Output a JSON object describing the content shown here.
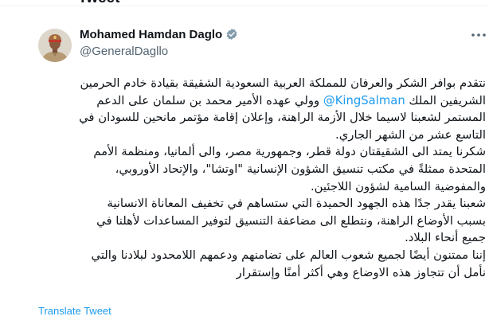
{
  "header": {
    "title": "Tweet"
  },
  "author": {
    "display_name": "Mohamed Hamdan Daglo",
    "handle": "@GeneralDagllo",
    "verified_icon": "verified-badge-icon",
    "verified_color": "#829aab"
  },
  "tweet": {
    "line1": "نتقدم بوافر الشكر والعرفان للمملكة العربية السعودية الشقيقة بقيادة خادم الحرمين",
    "line2_before": "الشريفين الملك",
    "mention": "@KingSalman",
    "line2_after": "وولي عهده الأمير محمد بن سلمان على الدعم",
    "line3": "المستمر لشعبنا لاسيما خلال الأزمة الراهنة، وإعلان إقامة مؤتمر مانحين للسودان في",
    "line4": "التاسع عشر من الشهر الجاري.",
    "line5": "شكرنا يمتد الى الشقيقتان دولة قطر، وجمهورية مصر، والى ألمانيا، ومنظمة الأمم",
    "line6": "المتحدة ممثلةً في مكتب تنسيق الشؤون الإنسانية \"اوتشا\"، والإتحاد الأوروبي،",
    "line7": "والمفوضية السامية لشؤون اللاجئين.",
    "line8": "شعبنا يقدر جدًا هذه الجهود الحميدة التي ستساهم  في تخفيف المعاناة الانسانية",
    "line9": "بسبب  الأوضاع الراهنة، ونتطلع الى مضاعفة التنسيق لتوفير المساعدات لأهلنا في",
    "line10": "جميع أنحاء البلاد.",
    "line11": "إننا ممتنون أيضًا لجميع شعوب العالم على تضامنهم ودعمهم اللامحدود لبلادنا والتي",
    "line12": "نأمل أن تتجاوز هذه الاوضاع وهي أكثر أمنًا وإستقرار"
  },
  "actions": {
    "translate_label": "Translate Tweet",
    "more_icon": "more-options-icon",
    "link_color": "#1d9bf0"
  }
}
